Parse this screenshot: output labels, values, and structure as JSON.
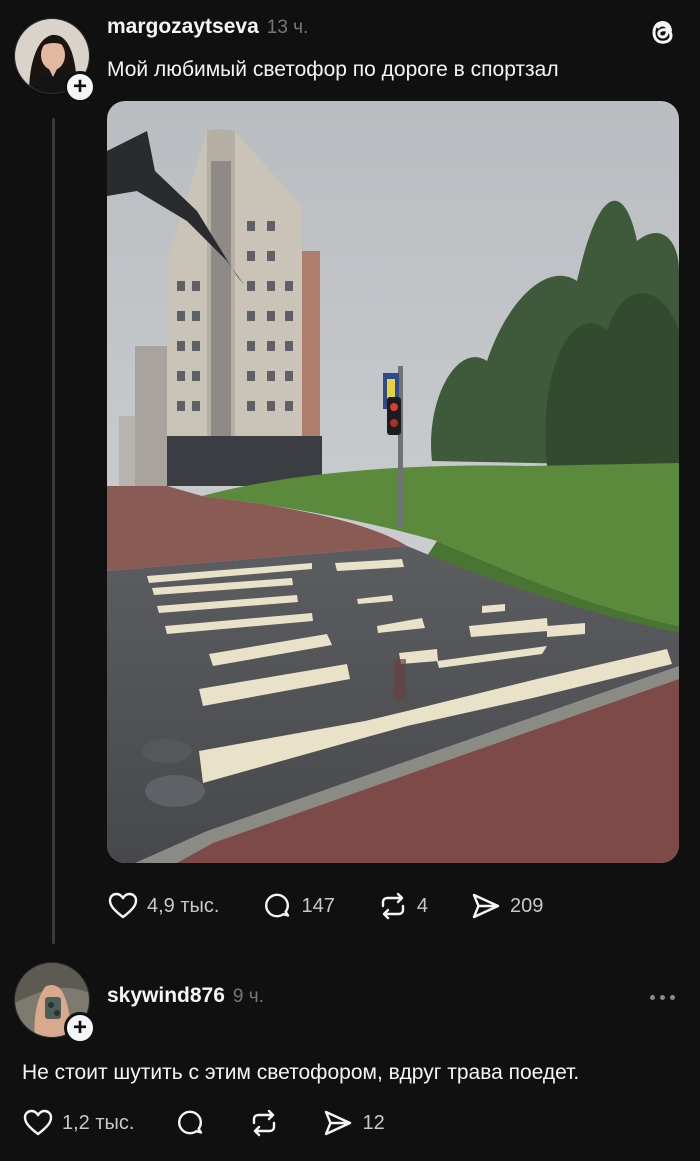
{
  "post": {
    "username": "margozaytseva",
    "time": "13 ч.",
    "text": "Мой любимый светофор по дороге в спортзал",
    "likes": "4,9 тыс.",
    "comments": "147",
    "reposts": "4",
    "shares": "209"
  },
  "reply": {
    "username": "skywind876",
    "time": "9 ч.",
    "text": "Не стоит шутить с этим светофором, вдруг трава поедет.",
    "likes": "1,2 тыс.",
    "shares": "12"
  },
  "icons": {
    "app_logo": "threads-logo-icon",
    "like": "heart-icon",
    "comment": "speech-bubble-icon",
    "repost": "repost-icon",
    "share": "send-icon",
    "follow": "plus-icon",
    "more": "more-dots-icon"
  },
  "colors": {
    "background": "#101010",
    "text": "#f3f5f7",
    "secondary": "#777777",
    "thread_line": "#3a3a3a"
  }
}
